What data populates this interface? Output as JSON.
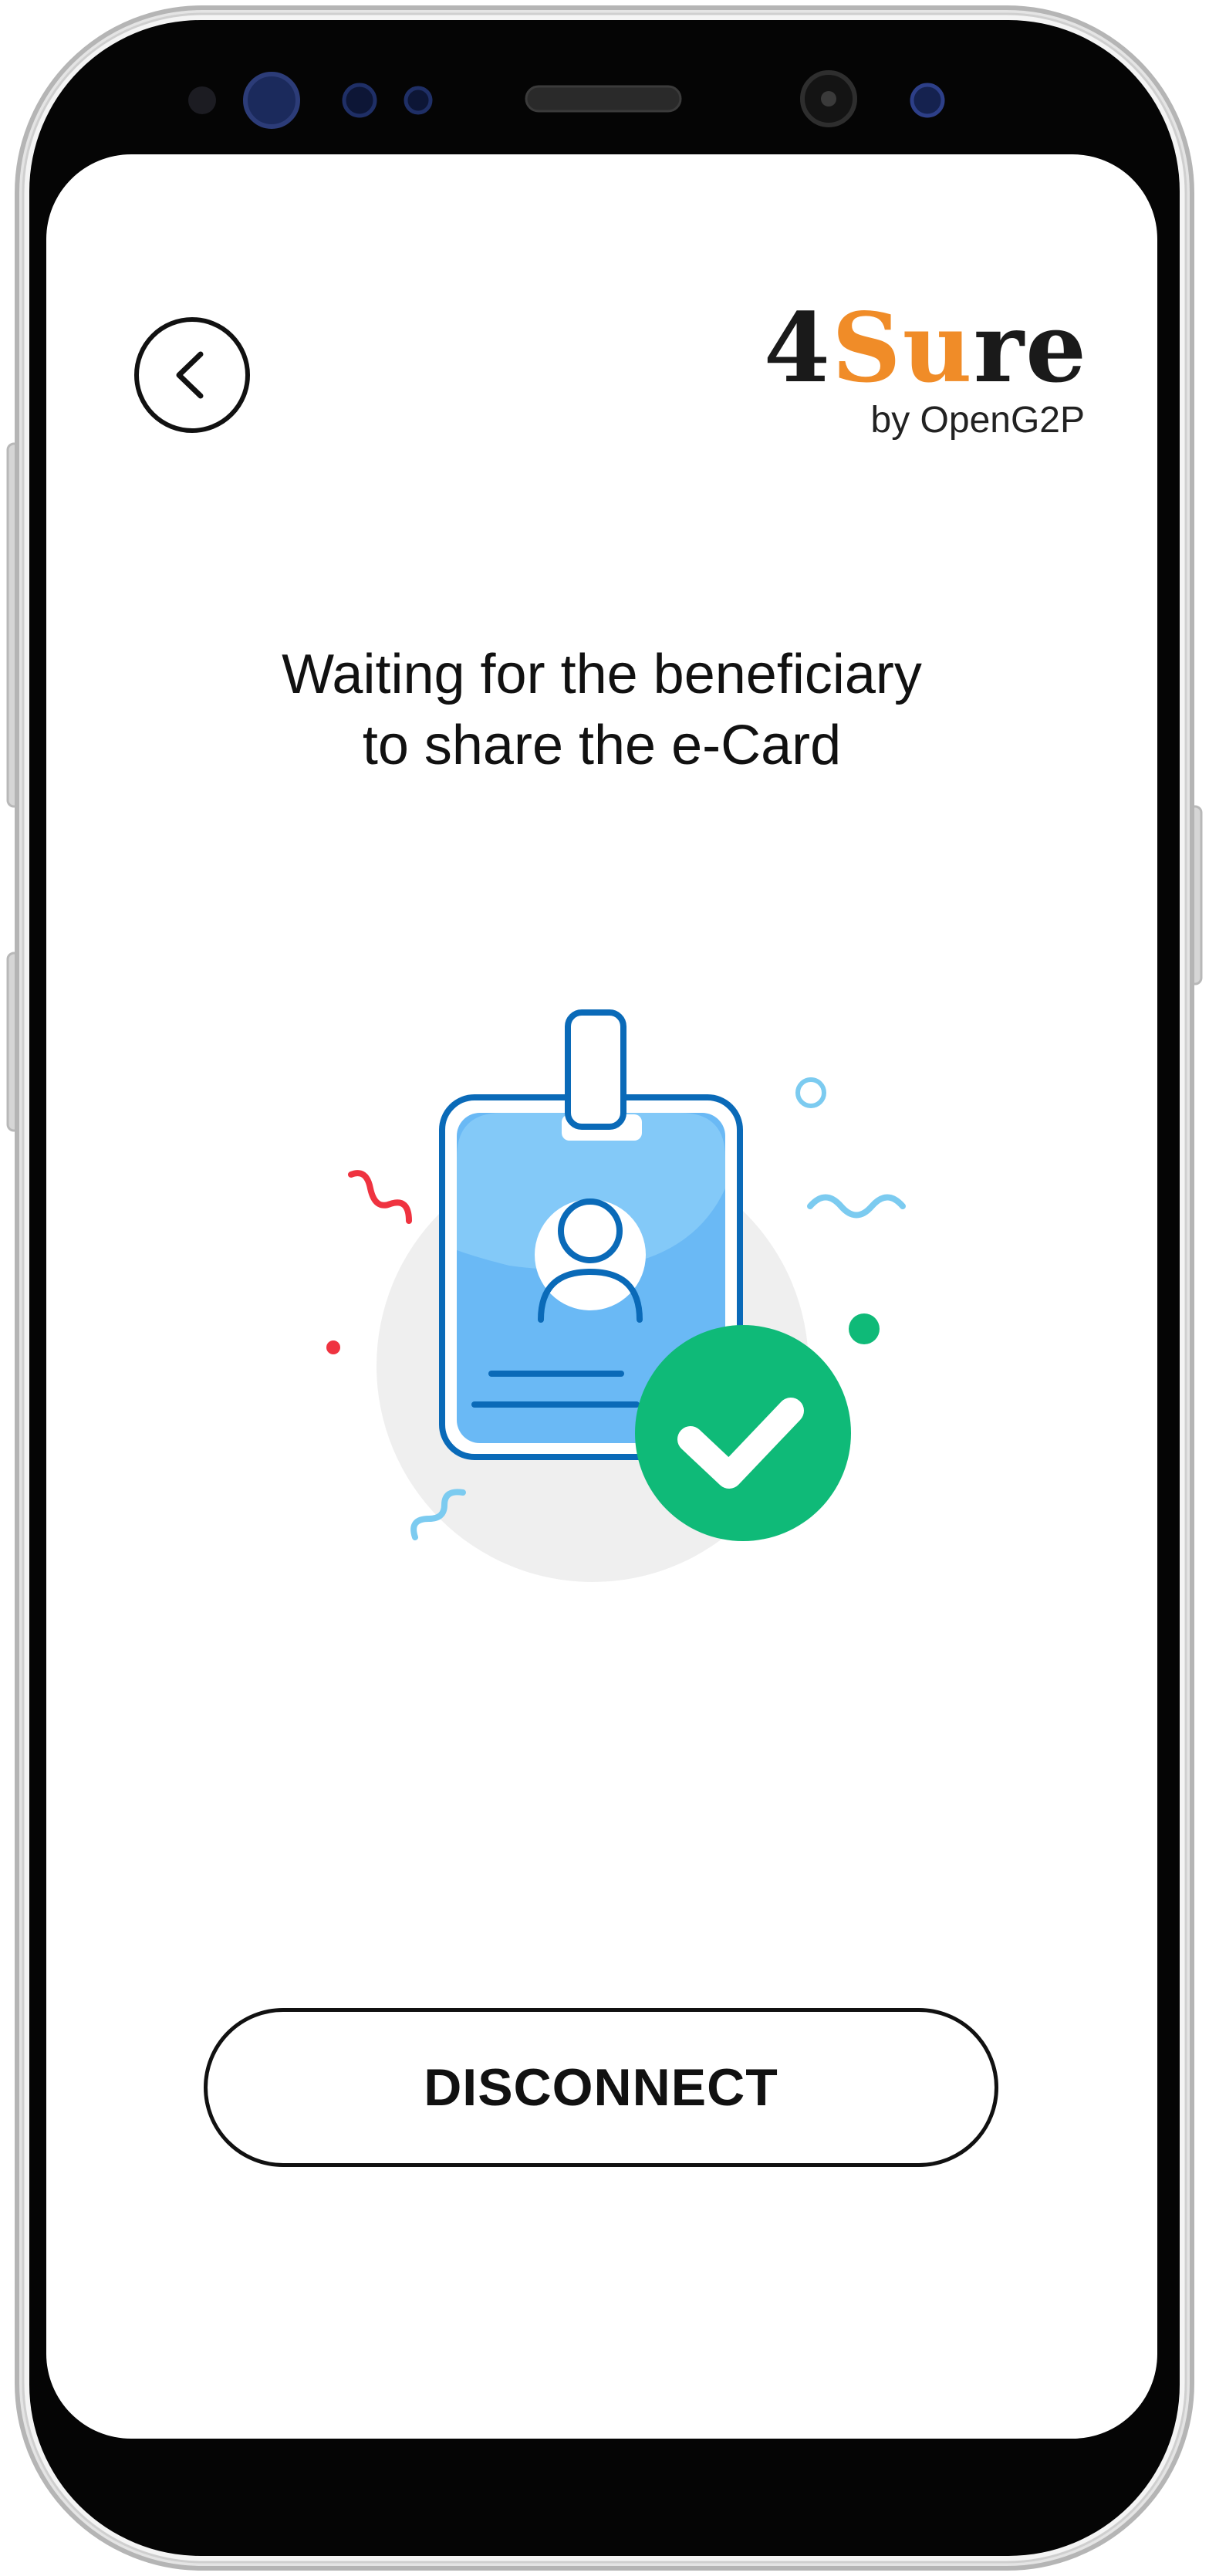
{
  "header": {
    "back_icon": "chevron-left-icon",
    "logo": {
      "prefix": "4",
      "highlight": "Su",
      "suffix": "re",
      "tagline": "by OpenG2P"
    }
  },
  "main": {
    "title_line1": "Waiting for the beneficiary",
    "title_line2": "to share the e-Card",
    "illustration_icon": "id-card-check-icon"
  },
  "footer": {
    "disconnect_label": "DISCONNECT"
  },
  "colors": {
    "logo_dark": "#1a1a1a",
    "logo_orange": "#f08c28",
    "logo_yellow": "#f2b233",
    "card_blue": "#6ab9f5",
    "card_outline": "#0a6ab8",
    "check_green": "#0fba78",
    "confetti_red": "#ef3340",
    "confetti_light_blue": "#7ccbf0"
  }
}
